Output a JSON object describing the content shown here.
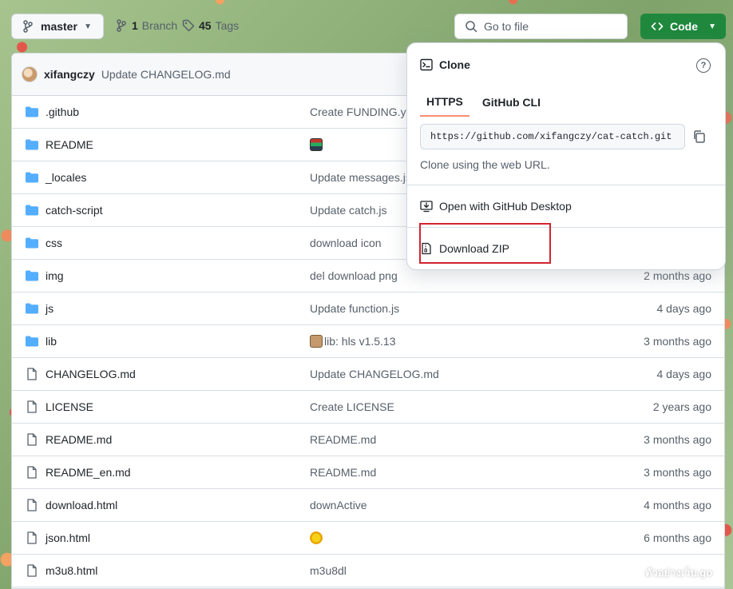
{
  "toolbar": {
    "branch_name": "master",
    "branch_count": "1",
    "branch_label": "Branch",
    "tag_count": "45",
    "tag_label": "Tags",
    "search_placeholder": "Go to file",
    "code_label": "Code"
  },
  "commit": {
    "author": "xifangczy",
    "message": "Update CHANGELOG.md"
  },
  "files": [
    {
      "type": "folder",
      "name": ".github",
      "message": "Create FUNDING.yml",
      "date": ""
    },
    {
      "type": "folder",
      "name": "README",
      "message": "",
      "emoji": "books",
      "date": ""
    },
    {
      "type": "folder",
      "name": "_locales",
      "message": "Update messages.json",
      "date": ""
    },
    {
      "type": "folder",
      "name": "catch-script",
      "message": "Update catch.js",
      "date": ""
    },
    {
      "type": "folder",
      "name": "css",
      "message": "download icon",
      "date": ""
    },
    {
      "type": "folder",
      "name": "img",
      "message": "del download png",
      "date": "2 months ago"
    },
    {
      "type": "folder",
      "name": "js",
      "message": "Update function.js",
      "date": "4 days ago"
    },
    {
      "type": "folder",
      "name": "lib",
      "message": "lib: hls v1.5.13",
      "emoji": "package",
      "date": "3 months ago"
    },
    {
      "type": "file",
      "name": "CHANGELOG.md",
      "message": "Update CHANGELOG.md",
      "date": "4 days ago"
    },
    {
      "type": "file",
      "name": "LICENSE",
      "message": "Create LICENSE",
      "date": "2 years ago"
    },
    {
      "type": "file",
      "name": "README.md",
      "message": "README.md",
      "date": "3 months ago"
    },
    {
      "type": "file",
      "name": "README_en.md",
      "message": "README.md",
      "date": "3 months ago"
    },
    {
      "type": "file",
      "name": "download.html",
      "message": "downActive",
      "date": "4 months ago"
    },
    {
      "type": "file",
      "name": "json.html",
      "message": "",
      "emoji": "sun",
      "date": "6 months ago"
    },
    {
      "type": "file",
      "name": "m3u8.html",
      "message": "m3u8dl",
      "date": ""
    }
  ],
  "clone": {
    "title": "Clone",
    "tab_https": "HTTPS",
    "tab_cli": "GitHub CLI",
    "url": "https://github.com/xifangczy/cat-catch.git",
    "note": "Clone using the web URL.",
    "open_desktop": "Open with GitHub Desktop",
    "download_zip": "Download ZIP"
  },
  "colors": {
    "code_button": "#1f883d",
    "tab_underline": "#fd8c73",
    "folder_icon": "#54aeff",
    "highlight": "#d1242f"
  },
  "watermark": "ตัวอย่างเว็บ.go"
}
